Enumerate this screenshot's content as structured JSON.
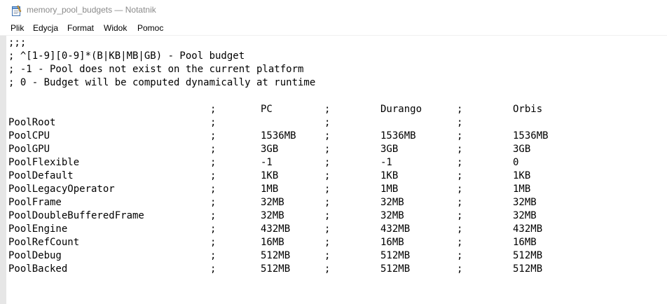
{
  "window": {
    "title": "memory_pool_budgets — Notatnik"
  },
  "icons": {
    "app": "notepad-icon"
  },
  "menu": [
    "Plik",
    "Edycja",
    "Format",
    "Widok",
    "Pomoc"
  ],
  "comments": [
    ";;;",
    "; ^[1-9][0-9]*(B|KB|MB|GB) - Pool budget",
    "; -1 - Pool does not exist on the current platform",
    "; 0 - Budget will be computed dynamically at runtime"
  ],
  "table": {
    "separator": ";",
    "headers": [
      "PC",
      "Durango",
      "Orbis"
    ],
    "rows": [
      {
        "name": "PoolRoot",
        "pc": "",
        "durango": "",
        "orbis": ""
      },
      {
        "name": "PoolCPU",
        "pc": "1536MB",
        "durango": "1536MB",
        "orbis": "1536MB"
      },
      {
        "name": "PoolGPU",
        "pc": "3GB",
        "durango": "3GB",
        "orbis": "3GB"
      },
      {
        "name": "PoolFlexible",
        "pc": "-1",
        "durango": "-1",
        "orbis": "0"
      },
      {
        "name": "PoolDefault",
        "pc": "1KB",
        "durango": "1KB",
        "orbis": "1KB"
      },
      {
        "name": "PoolLegacyOperator",
        "pc": "1MB",
        "durango": "1MB",
        "orbis": "1MB"
      },
      {
        "name": "PoolFrame",
        "pc": "32MB",
        "durango": "32MB",
        "orbis": "32MB"
      },
      {
        "name": "PoolDoubleBufferedFrame",
        "pc": "32MB",
        "durango": "32MB",
        "orbis": "32MB"
      },
      {
        "name": "PoolEngine",
        "pc": "432MB",
        "durango": "432MB",
        "orbis": "432MB"
      },
      {
        "name": "PoolRefCount",
        "pc": "16MB",
        "durango": "16MB",
        "orbis": "16MB"
      },
      {
        "name": "PoolDebug",
        "pc": "512MB",
        "durango": "512MB",
        "orbis": "512MB"
      },
      {
        "name": "PoolBacked",
        "pc": "512MB",
        "durango": "512MB",
        "orbis": "512MB"
      }
    ]
  }
}
